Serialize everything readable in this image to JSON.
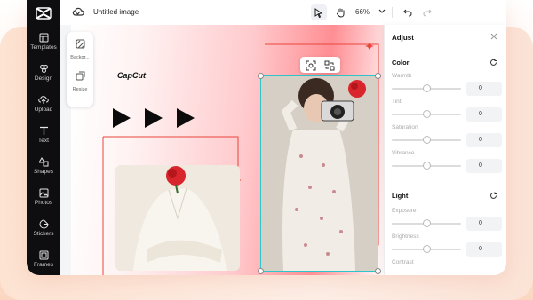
{
  "topbar": {
    "title": "Untitled image",
    "zoom": "66%"
  },
  "rail": {
    "items": [
      {
        "label": "Templates"
      },
      {
        "label": "Design"
      },
      {
        "label": "Upload"
      },
      {
        "label": "Text"
      },
      {
        "label": "Shapes"
      },
      {
        "label": "Photos"
      },
      {
        "label": "Stickers"
      },
      {
        "label": "Frames"
      }
    ]
  },
  "mini_toolbar": {
    "background_label": "Backgr...",
    "resize_label": "Resize"
  },
  "canvas": {
    "brand_text": "CapCut"
  },
  "panel": {
    "title": "Adjust",
    "color_section": "Color",
    "light_section": "Light",
    "color_sliders": [
      {
        "name": "Warmth",
        "value": "0"
      },
      {
        "name": "Tint",
        "value": "0"
      },
      {
        "name": "Saturation",
        "value": "0"
      },
      {
        "name": "Vibrance",
        "value": "0"
      }
    ],
    "light_sliders": [
      {
        "name": "Exposure",
        "value": "0"
      },
      {
        "name": "Brightness",
        "value": "0"
      },
      {
        "name": "Contrast",
        "value": ""
      }
    ]
  },
  "colors": {
    "accent": "#2ec4c8",
    "rail_bg": "#0e0e10",
    "frame_red": "#e8453c"
  }
}
